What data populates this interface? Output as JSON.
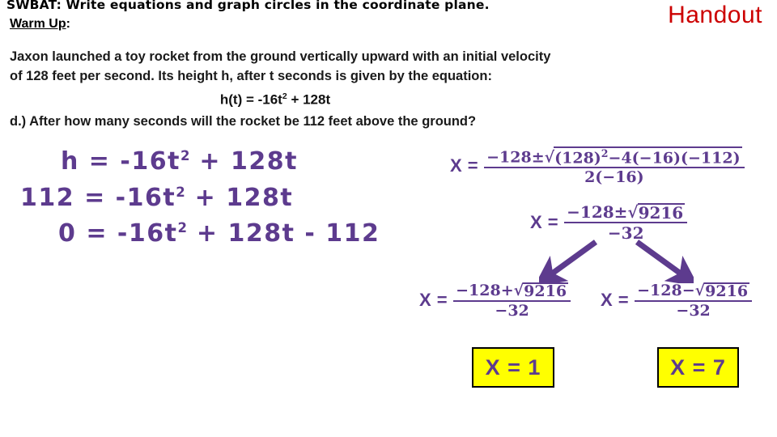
{
  "header": {
    "swbat": "SWBAT:  Write equations and graph circles in the coordinate plane.",
    "warm_up_label": "Warm Up",
    "warm_up_colon": ":",
    "handout_label": "Handout",
    "handout_color": "#CC0000"
  },
  "problem": {
    "body": "Jaxon launched a toy rocket from the ground vertically upward with an initial velocity of 128 feet per second. Its height h, after t seconds is given by the equation:",
    "equation_prefix": "h(t) = -16t",
    "equation_exponent": "2",
    "equation_suffix": " + 128t",
    "question": "d.) After how many seconds will the rocket be 112 feet above the ground?"
  },
  "work": {
    "color": "#5D3B8E",
    "steps": [
      {
        "lhs": "h",
        "rel": " = ",
        "rhs_a": "-16t",
        "exp": "2",
        "rhs_b": " + 128t"
      },
      {
        "lhs": "112",
        "rel": " = ",
        "rhs_a": "-16t",
        "exp": "2",
        "rhs_b": " + 128t"
      },
      {
        "lhs": "0",
        "rel": " = ",
        "rhs_a": "-16t",
        "exp": "2",
        "rhs_b": " + 128t - 112"
      }
    ]
  },
  "quadratic": {
    "step1": {
      "lhs": "X =",
      "num_lead": "−128±",
      "radicand_a": "(128)",
      "radicand_exp": "2",
      "radicand_b": "−4(−16)(−112)",
      "den": "2(−16)"
    },
    "step2": {
      "lhs": "X =",
      "num_lead": "−128±",
      "radicand": "9216",
      "den": "−32"
    },
    "branch_plus": {
      "lhs": "X =",
      "num_lead": "−128+",
      "radicand": "9216",
      "den": "−32"
    },
    "branch_minus": {
      "lhs": "X =",
      "num_lead": "−128−",
      "radicand": "9216",
      "den": "−32"
    },
    "radical_sign": "√"
  },
  "answers": {
    "box_fill": "#FFFF00",
    "left": "X = 1",
    "right": "X = 7"
  },
  "arrows": {
    "left_label": "arrow-down-left",
    "right_label": "arrow-down-right"
  }
}
